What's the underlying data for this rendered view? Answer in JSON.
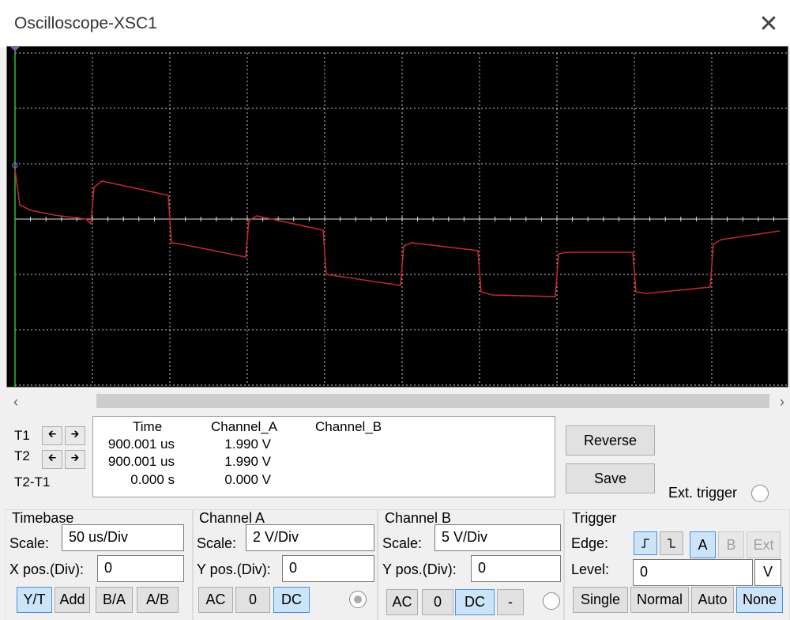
{
  "window": {
    "title": "Oscilloscope-XSC1",
    "close_icon": "close-icon"
  },
  "screen": {
    "background": "#000000",
    "grid_color": "#c8c8c8",
    "trace_color": "#c0282a",
    "cursor_color": "#2bbf2b"
  },
  "cursors": {
    "t1_label": "T1",
    "t2_label": "T2",
    "diff_label": "T2-T1",
    "left_arrow": "🡰",
    "right_arrow": "🡲"
  },
  "readout": {
    "headers": [
      "Time",
      "Channel_A",
      "Channel_B"
    ],
    "rows": [
      {
        "time": "900.001 us",
        "channel_a": "1.990 V",
        "channel_b": ""
      },
      {
        "time": "900.001 us",
        "channel_a": "1.990 V",
        "channel_b": ""
      },
      {
        "time": "0.000 s",
        "channel_a": "0.000 V",
        "channel_b": ""
      }
    ]
  },
  "buttons": {
    "reverse": "Reverse",
    "save": "Save",
    "ext_trigger": "Ext. trigger"
  },
  "timebase": {
    "title": "Timebase",
    "scale_label": "Scale:",
    "scale_value": "50 us/Div",
    "xpos_label": "X pos.(Div):",
    "xpos_value": "0",
    "modes": [
      "Y/T",
      "Add",
      "B/A",
      "A/B"
    ],
    "active_mode": "Y/T"
  },
  "channel_a": {
    "title": "Channel A",
    "scale_label": "Scale:",
    "scale_value": "2  V/Div",
    "ypos_label": "Y pos.(Div):",
    "ypos_value": "0",
    "coupling": [
      "AC",
      "0",
      "DC"
    ],
    "active_coupling": "DC"
  },
  "channel_b": {
    "title": "Channel B",
    "scale_label": "Scale:",
    "scale_value": "5  V/Div",
    "ypos_label": "Y pos.(Div):",
    "ypos_value": "0",
    "coupling": [
      "AC",
      "0",
      "DC",
      "-"
    ],
    "active_coupling": "DC"
  },
  "trigger": {
    "title": "Trigger",
    "edge_label": "Edge:",
    "level_label": "Level:",
    "level_value": "0",
    "level_unit": "V",
    "sources": [
      "A",
      "B",
      "Ext"
    ],
    "active_source": "A",
    "modes": [
      "Single",
      "Normal",
      "Auto",
      "None"
    ],
    "active_mode": "None"
  },
  "scrollbar": {
    "left_arrow": "‹",
    "right_arrow": "›"
  }
}
